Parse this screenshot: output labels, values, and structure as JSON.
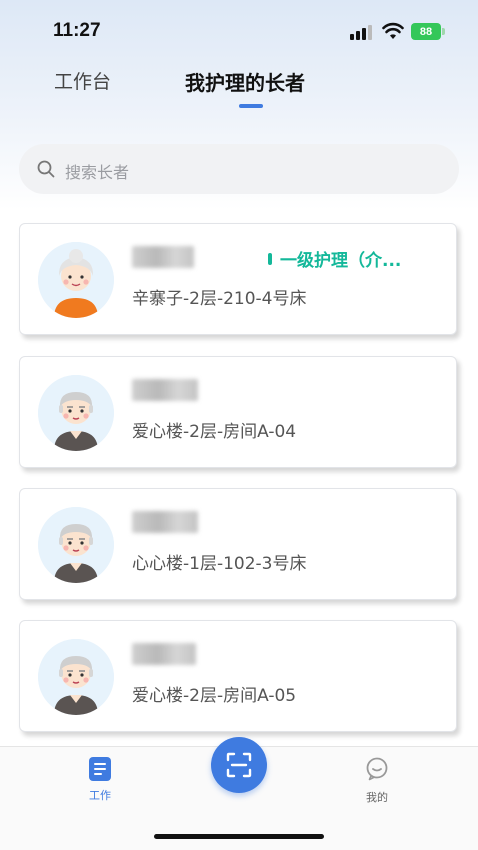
{
  "status_bar": {
    "time": "11:27",
    "battery": "88"
  },
  "header": {
    "tabs": [
      {
        "label": "工作台",
        "active": false
      },
      {
        "label": "我护理的长者",
        "active": true
      }
    ]
  },
  "search": {
    "placeholder": "搜索长者"
  },
  "elders": [
    {
      "avatar": "elderly-woman-avatar",
      "location": "辛寨子-2层-210-4号床",
      "care_level": "一级护理（介..."
    },
    {
      "avatar": "elderly-man-avatar",
      "location": "爱心楼-2层-房间A-04"
    },
    {
      "avatar": "elderly-man-avatar",
      "location": "心心楼-1层-102-3号床"
    },
    {
      "avatar": "elderly-man-avatar",
      "location": "爱心楼-2层-房间A-05"
    }
  ],
  "bottom_nav": {
    "work_label": "工作",
    "mine_label": "我的",
    "scan_icon": "scan-icon"
  },
  "colors": {
    "accent": "#3f7be0",
    "care_level": "#14b89a"
  }
}
